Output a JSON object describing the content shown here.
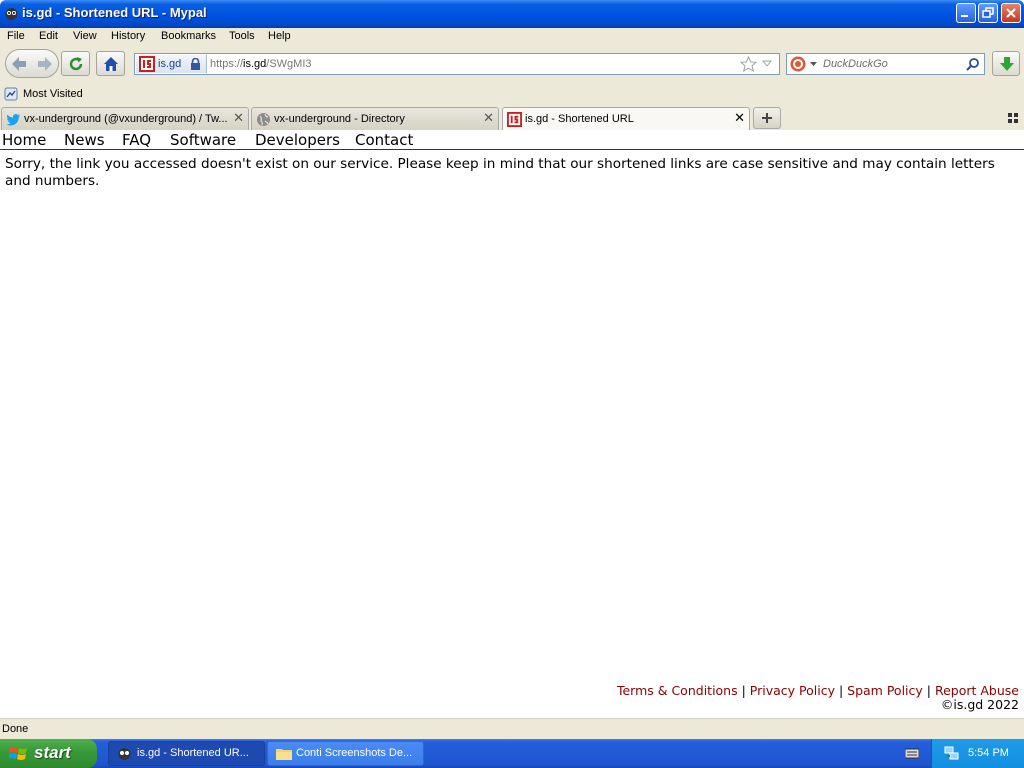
{
  "window": {
    "title": "is.gd - Shortened URL - Mypal"
  },
  "menu": {
    "items": [
      "File",
      "Edit",
      "View",
      "History",
      "Bookmarks",
      "Tools",
      "Help"
    ]
  },
  "navbar": {
    "identity_label": "is.gd",
    "url_prefix": "https://",
    "url_host": "is.gd",
    "url_path": "/SWgMI3",
    "search_placeholder": "DuckDuckGo"
  },
  "bookmarks": {
    "most_visited": "Most Visited"
  },
  "tabs": [
    {
      "label": "vx-underground (@vxunderground) / Tw...",
      "icon": "twitter-icon",
      "active": false
    },
    {
      "label": "vx-underground - Directory",
      "icon": "globe-icon",
      "active": false
    },
    {
      "label": "is.gd - Shortened URL",
      "icon": "isgd-icon",
      "active": true
    }
  ],
  "page": {
    "nav": [
      "Home",
      "News",
      "FAQ",
      "Software",
      "Developers",
      "Contact"
    ],
    "message": "Sorry, the link you accessed doesn't exist on our service. Please keep in mind that our shortened links are case sensitive and may contain letters and numbers.",
    "footer": {
      "links": [
        "Terms & Conditions",
        "Privacy Policy",
        "Spam Policy",
        "Report Abuse"
      ],
      "copyright": "©is.gd 2022"
    }
  },
  "status": {
    "text": "Done"
  },
  "taskbar": {
    "start_label": "start",
    "items": [
      {
        "label": "is.gd - Shortened UR...",
        "active": true
      },
      {
        "label": "Conti Screenshots De...",
        "active": false
      }
    ],
    "clock": "5:54 PM"
  },
  "colors": {
    "link": "#8b0000",
    "nav_rule": "#b50000",
    "titlebar": "#0054e3"
  }
}
